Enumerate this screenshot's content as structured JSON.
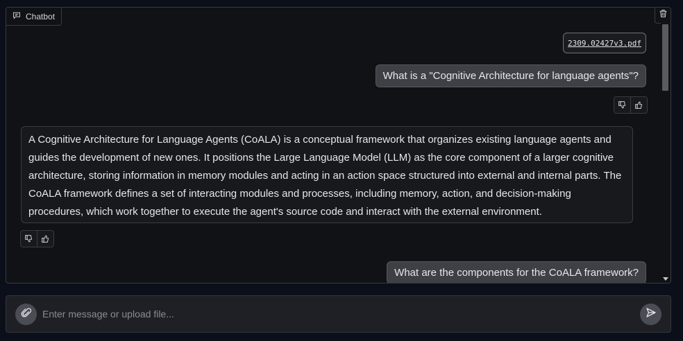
{
  "chatbot": {
    "tab_label": "Chatbot",
    "messages": {
      "file_name": "2309.02427v3.pdf",
      "user_question_1": "What is a \"Cognitive Architecture for language agents\"?",
      "bot_answer_1": "A Cognitive Architecture for Language Agents (CoALA) is a conceptual framework that organizes existing language agents and guides the development of new ones. It positions the Large Language Model (LLM) as the core component of a larger cognitive architecture, storing information in memory modules and acting in an action space structured into external and internal parts. The CoALA framework defines a set of interacting modules and processes, including memory, action, and decision-making procedures, which work together to execute the agent's source code and interact with the external environment.",
      "user_question_2": "What are the components for the CoALA framework?"
    }
  },
  "composer": {
    "placeholder": "Enter message or upload file..."
  },
  "icons": {
    "tab": "chat-bubble-icon",
    "clear": "trash-icon",
    "dislike": "thumbs-down-icon",
    "like": "thumbs-up-icon",
    "attach": "paperclip-icon",
    "send": "send-icon"
  }
}
